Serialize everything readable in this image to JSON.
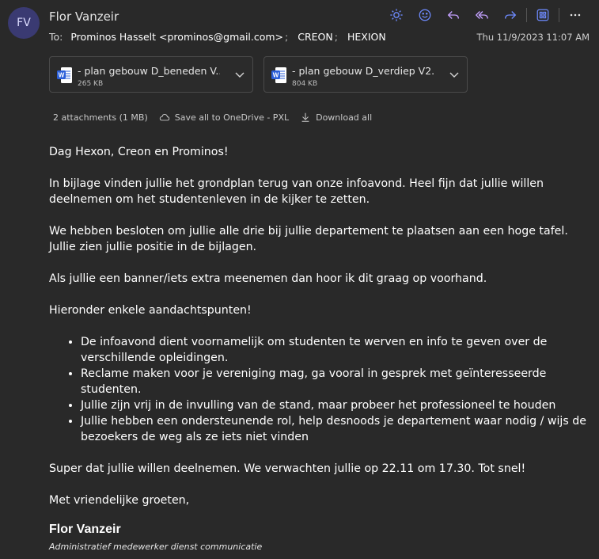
{
  "sender": {
    "initials": "FV",
    "name": "Flor Vanzeir"
  },
  "toolbar": {
    "icons": [
      "brightness-icon",
      "emoji-icon",
      "reply-icon",
      "reply-all-icon",
      "forward-icon",
      "apps-icon",
      "more-icon"
    ]
  },
  "recipients": {
    "label": "To:",
    "list": [
      "Prominos Hasselt <prominos@gmail.com>",
      "CREON",
      "HEXION"
    ],
    "separator": ";"
  },
  "date": "Thu 11/9/2023 11:07 AM",
  "attachments": [
    {
      "name": "- plan gebouw D_beneden V...",
      "size": "265 KB"
    },
    {
      "name": "- plan gebouw D_verdiep V2...",
      "size": "804 KB"
    }
  ],
  "attachment_actions": {
    "summary": "2 attachments (1 MB)",
    "save": "Save all to OneDrive - PXL",
    "download": "Download all"
  },
  "body": {
    "greeting": "Dag Hexon, Creon en Prominos!",
    "paragraphs": [
      "In bijlage vinden jullie het grondplan terug van onze infoavond. Heel fijn dat jullie willen deelnemen om het studentenleven in de kijker te zetten.",
      "We hebben besloten om jullie alle drie bij jullie departement te plaatsen aan een hoge tafel. Jullie zien jullie positie in de bijlagen.",
      "Als jullie een banner/iets extra meenemen dan hoor ik dit graag op voorhand.",
      "Hieronder enkele aandachtspunten!"
    ],
    "bullets": [
      "De infoavond dient voornamelijk om studenten te werven en info te geven over de verschillende opleidingen.",
      "Reclame maken voor je vereniging mag, ga vooral in gesprek met geïnteresseerde studenten.",
      "Jullie zijn vrij in de invulling van de stand, maar probeer het professioneel te houden",
      "Jullie hebben een ondersteunende rol, help desnoods je departement waar nodig / wijs de bezoekers de weg als ze iets niet vinden"
    ],
    "closing": "Super dat jullie willen deelnemen. We verwachten jullie op 22.11 om 17.30. Tot snel!",
    "regards": "Met vriendelijke groeten,"
  },
  "signature": {
    "name": "Flor Vanzeir",
    "title": "Administratief medewerker dienst communicatie"
  },
  "colors": {
    "background": "#292929",
    "accent": "#6e8bff",
    "avatar": "#3a3a72",
    "word": "#2b5fd9"
  }
}
